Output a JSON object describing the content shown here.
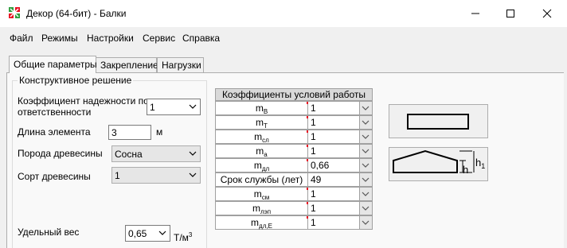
{
  "window": {
    "title": "Декор (64-бит) - Балки"
  },
  "menu": {
    "items": [
      "Файл",
      "Режимы",
      "Настройки",
      "Сервис",
      "Справка"
    ]
  },
  "tabs": [
    {
      "label": "Общие параметры",
      "active": true
    },
    {
      "label": "Закрепление",
      "active": false
    },
    {
      "label": "Нагрузки",
      "active": false
    }
  ],
  "group": {
    "title": "Конструктивное решение"
  },
  "fields": {
    "reliability_label_line1": "Коэффициент надежности по",
    "reliability_label_line2": "ответственности",
    "reliability_value": "1",
    "length_label": "Длина элемента",
    "length_value": "3",
    "length_unit": "м",
    "wood_label": "Порода древесины",
    "wood_value": "Сосна",
    "grade_label": "Сорт древесины",
    "grade_value": "1",
    "weight_label": "Удельный вес",
    "weight_value": "0,65",
    "weight_unit": "Т/м",
    "weight_unit_sup": "3"
  },
  "coef_table": {
    "header": "Коэффициенты условий работы",
    "rows": [
      {
        "base": "m",
        "sub": "В",
        "value": "1"
      },
      {
        "base": "m",
        "sub": "Т",
        "value": "1"
      },
      {
        "base": "m",
        "sub": "сл",
        "value": "1"
      },
      {
        "base": "m",
        "sub": "а",
        "value": "1"
      },
      {
        "base": "m",
        "sub": "дл",
        "value": "0,66"
      },
      {
        "base": "Срок службы (лет)",
        "sub": "",
        "value": "49"
      },
      {
        "base": "m",
        "sub": "см",
        "value": "1"
      },
      {
        "base": "m",
        "sub": "лэп",
        "value": "1"
      },
      {
        "base": "m",
        "sub": "дл,Е",
        "value": "1"
      }
    ]
  },
  "section_labels": {
    "h": "h",
    "h1": "h",
    "h1_sub": "1"
  },
  "colors": {
    "accent_red": "#e81123",
    "icon_green": "#2e9e3e"
  }
}
